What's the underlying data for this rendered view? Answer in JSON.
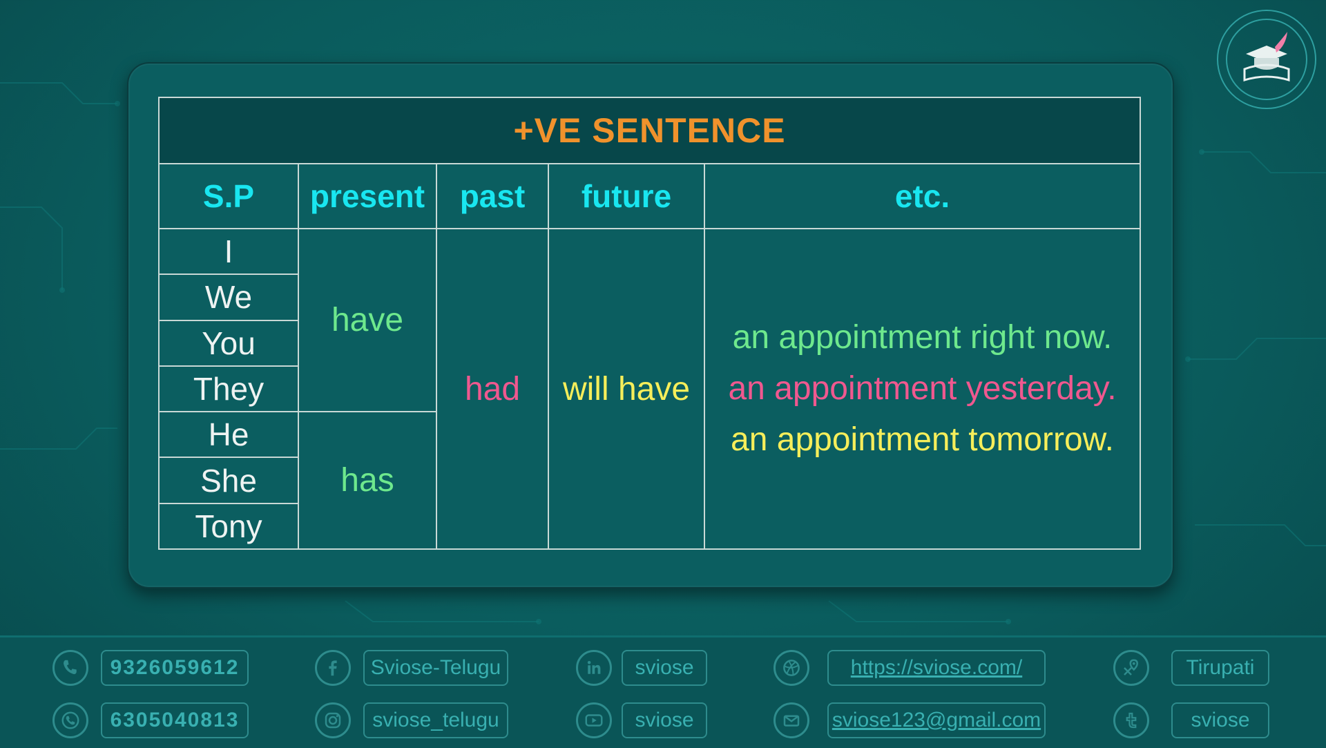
{
  "table": {
    "title": "+VE SENTENCE",
    "headers": [
      "S.P",
      "present",
      "past",
      "future",
      "etc."
    ],
    "subjects": [
      "I",
      "We",
      "You",
      "They",
      "He",
      "She",
      "Tony"
    ],
    "present": [
      "have",
      "has"
    ],
    "past": "had",
    "future": "will have",
    "etc": [
      "an appointment right now.",
      "an appointment yesterday.",
      "an appointment tomorrow."
    ]
  },
  "colors": {
    "title": "#f0922c",
    "header": "#19e6f0",
    "present": "#6ee88d",
    "past": "#f0588f",
    "future": "#f6ee5a"
  },
  "footer": {
    "phone": "9326059612",
    "whatsapp": "6305040813",
    "facebook": "Sviose-Telugu",
    "instagram": "sviose_telugu",
    "linkedin": "sviose",
    "youtube": "sviose",
    "website": "https://sviose.com/",
    "email": "sviose123@gmail.com",
    "location": "Tirupati",
    "other": "sviose"
  },
  "icons": [
    "phone-icon",
    "whatsapp-icon",
    "facebook-icon",
    "instagram-icon",
    "linkedin-icon",
    "youtube-icon",
    "globe-icon",
    "mail-icon",
    "location-icon",
    "social-icon"
  ]
}
